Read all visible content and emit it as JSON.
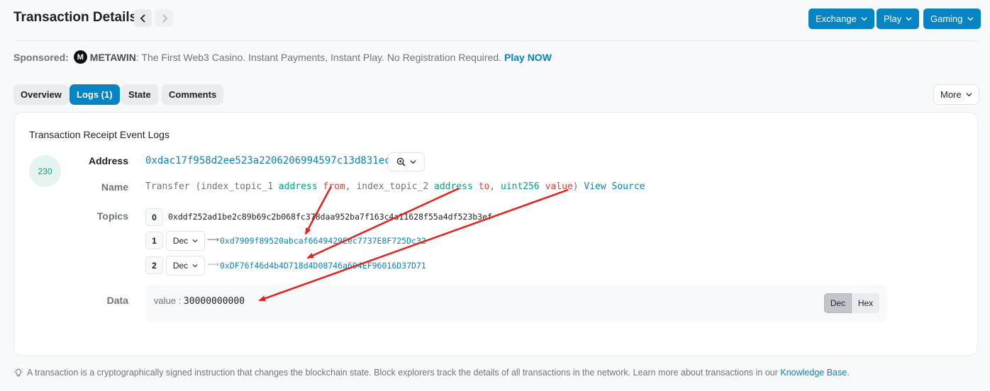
{
  "header": {
    "title": "Transaction Details",
    "menus": [
      {
        "label": "Exchange"
      },
      {
        "label": "Play"
      },
      {
        "label": "Gaming"
      }
    ]
  },
  "sponsor": {
    "label": "Sponsored:",
    "logo_letter": "M",
    "brand": "METAWIN",
    "message": ": The First Web3 Casino. Instant Payments, Instant Play. No Registration Required.",
    "cta": "Play NOW"
  },
  "tabs": [
    {
      "label": "Overview",
      "active": false
    },
    {
      "label": "Logs (1)",
      "active": true
    },
    {
      "label": "State",
      "active": false
    },
    {
      "label": "Comments",
      "active": false
    }
  ],
  "more": {
    "label": "More"
  },
  "log": {
    "section_title": "Transaction Receipt Event Logs",
    "index": "230",
    "address_label": "Address",
    "address": "0xdac17f958d2ee523a2206206994597c13d831ec7",
    "name_label": "Name",
    "name": {
      "event": "Transfer (",
      "p1_index": "index_topic_1 ",
      "p1_type": "address ",
      "p1_var": "from",
      "sep1": ", ",
      "p2_index": "index_topic_2 ",
      "p2_type": "address ",
      "p2_var": "to",
      "sep2": ", ",
      "p3_type": "uint256 ",
      "p3_var": "value",
      "close": ")",
      "view_source": "View Source"
    },
    "topics_label": "Topics",
    "topics": [
      {
        "index": "0",
        "value": "0xddf252ad1be2c89b69c2b068fc378daa952ba7f163c4a11628f55a4df523b3ef"
      },
      {
        "index": "1",
        "format": "Dec",
        "value": "0xd7909f89520abcaf6649429Eec7737E8F725Dc32"
      },
      {
        "index": "2",
        "format": "Dec",
        "value": "0xDF76f46d4b4D718d4D08746a694EF96016D37D71"
      }
    ],
    "data_label": "Data",
    "data": {
      "key": "value : ",
      "value": "30000000000",
      "toggle": [
        "Dec",
        "Hex"
      ]
    }
  },
  "footer": {
    "text": "A transaction is a cryptographically signed instruction that changes the blockchain state. Block explorers track the details of all transactions in the network. Learn more about transactions in our ",
    "link": "Knowledge Base",
    "end": "."
  },
  "colors": {
    "accent": "#0784c3",
    "annotation": "#e8211c",
    "type_green": "#00a186",
    "var_red": "#de4437"
  }
}
